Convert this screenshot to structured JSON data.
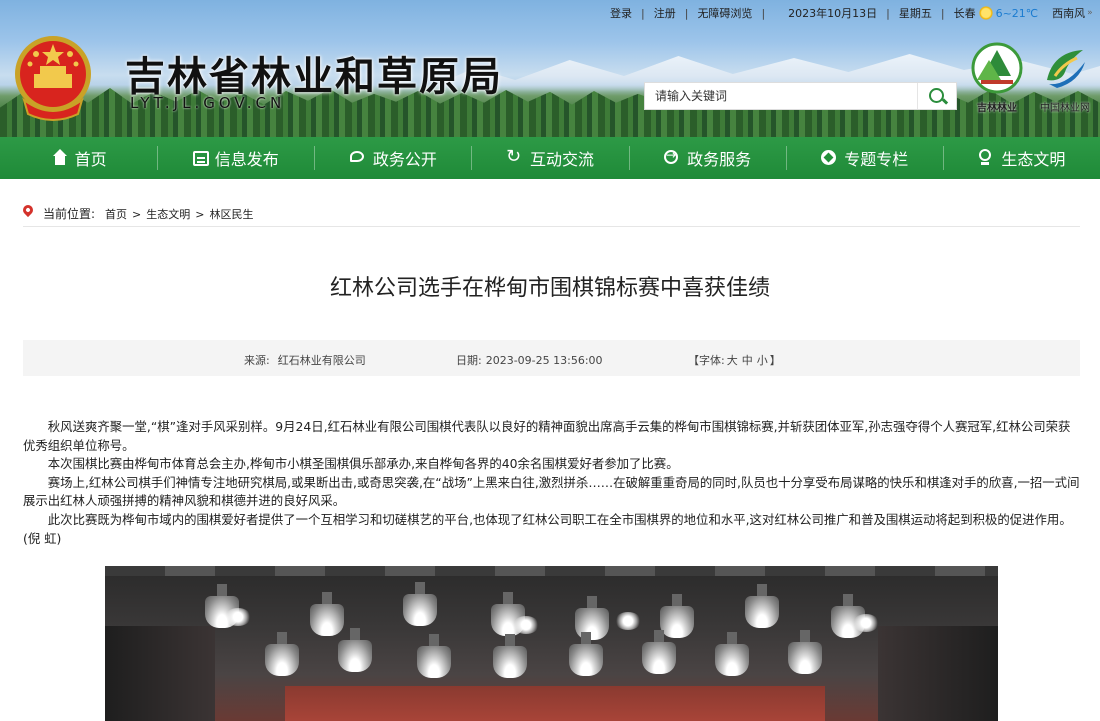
{
  "topbar": {
    "login": "登录",
    "register": "注册",
    "accessible": "无障碍浏览",
    "date": "2023年10月13日",
    "weekday": "星期五",
    "city": "长春",
    "temp": "6~21℃",
    "wind": "西南风"
  },
  "site": {
    "title": "吉林省林业和草原局",
    "url": "LYT.JL.GOV.CN"
  },
  "search": {
    "placeholder": "请输入关键词"
  },
  "logos": {
    "jilin": "吉林林业",
    "china": "中国林业网"
  },
  "nav": [
    {
      "label": "首页",
      "icon": "home-icon"
    },
    {
      "label": "信息发布",
      "icon": "document-icon"
    },
    {
      "label": "政务公开",
      "icon": "chat-icon"
    },
    {
      "label": "互动交流",
      "icon": "refresh-icon"
    },
    {
      "label": "政务服务",
      "icon": "service-icon"
    },
    {
      "label": "专题专栏",
      "icon": "compass-icon"
    },
    {
      "label": "生态文明",
      "icon": "location-icon"
    }
  ],
  "breadcrumb": {
    "label": "当前位置:",
    "items": [
      "首页",
      "生态文明",
      "林区民生"
    ],
    "separator": ">"
  },
  "article": {
    "title": "红林公司选手在桦甸市围棋锦标赛中喜获佳绩",
    "source_label": "来源:",
    "source": "红石林业有限公司",
    "date_label": "日期:",
    "date": "2023-09-25 13:56:00",
    "font_label": "【字体:",
    "font_large": "大",
    "font_medium": "中",
    "font_small": "小",
    "font_close": "】",
    "paragraphs": [
      "秋风送爽齐聚一堂,“棋”逢对手风采别样。9月24日,红石林业有限公司围棋代表队以良好的精神面貌出席高手云集的桦甸市围棋锦标赛,并斩获团体亚军,孙志强夺得个人赛冠军,红林公司荣获优秀组织单位称号。",
      "本次围棋比赛由桦甸市体育总会主办,桦甸市小棋圣围棋俱乐部承办,来自桦甸各界的40余名围棋爱好者参加了比赛。",
      "赛场上,红林公司棋手们神情专注地研究棋局,或果断出击,或奇思突袭,在“战场”上黑来白往,激烈拼杀……在破解重重奇局的同时,队员也十分享受布局谋略的快乐和棋逢对手的欣喜,一招一式间展示出红林人顽强拼搏的精神风貌和棋德并进的良好风采。",
      "此次比赛既为桦甸市域内的围棋爱好者提供了一个互相学习和切磋棋艺的平台,也体现了红林公司职工在全市围棋界的地位和水平,这对红林公司推广和普及围棋运动将起到积极的促进作用。(倪 虹)"
    ]
  },
  "colors": {
    "nav_green": "#219039",
    "pin_red": "#d4322b"
  }
}
